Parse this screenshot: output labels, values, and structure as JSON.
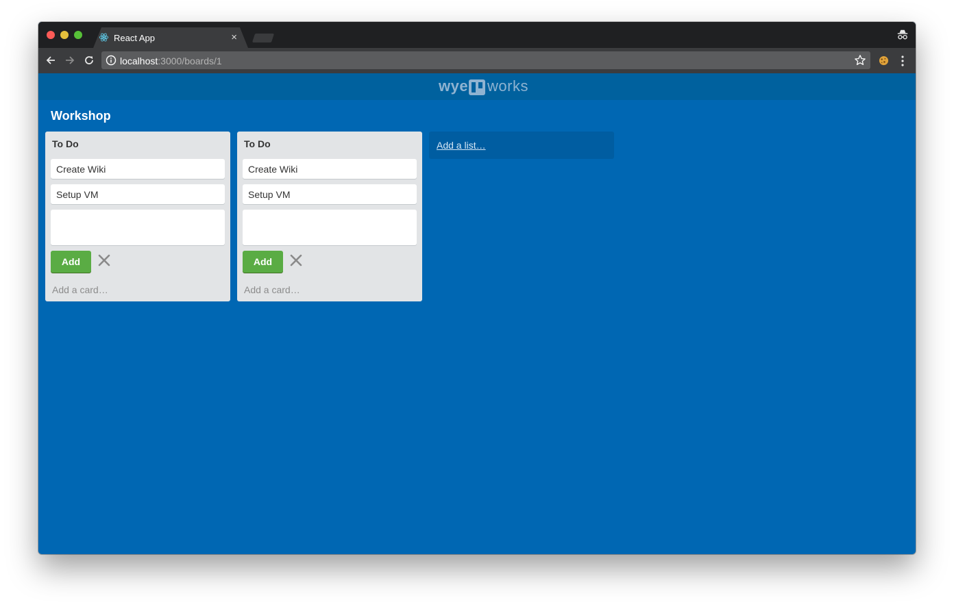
{
  "browser": {
    "tab_title": "React App",
    "tab_close": "×",
    "url_host": "localhost",
    "url_path": ":3000/boards/1"
  },
  "header": {
    "logo_left": "wye",
    "logo_right": "works"
  },
  "board": {
    "title": "Workshop",
    "lists": [
      {
        "title": "To Do",
        "cards": [
          "Create Wiki",
          "Setup VM"
        ],
        "add_button": "Add",
        "add_card": "Add a card…"
      },
      {
        "title": "To Do",
        "cards": [
          "Create Wiki",
          "Setup VM"
        ],
        "add_button": "Add",
        "add_card": "Add a card…"
      }
    ],
    "add_list": "Add a list…"
  },
  "colors": {
    "board_bg": "#0067b3",
    "header_bg": "#00619e",
    "list_bg": "#e2e4e6",
    "add_button": "#5aac44"
  },
  "icons": [
    "react-icon",
    "close-icon",
    "incognito-icon",
    "back-arrow-icon",
    "forward-arrow-icon",
    "reload-icon",
    "info-icon",
    "star-icon",
    "cookie-icon",
    "menu-icon",
    "logo-mark-icon",
    "cancel-icon"
  ]
}
